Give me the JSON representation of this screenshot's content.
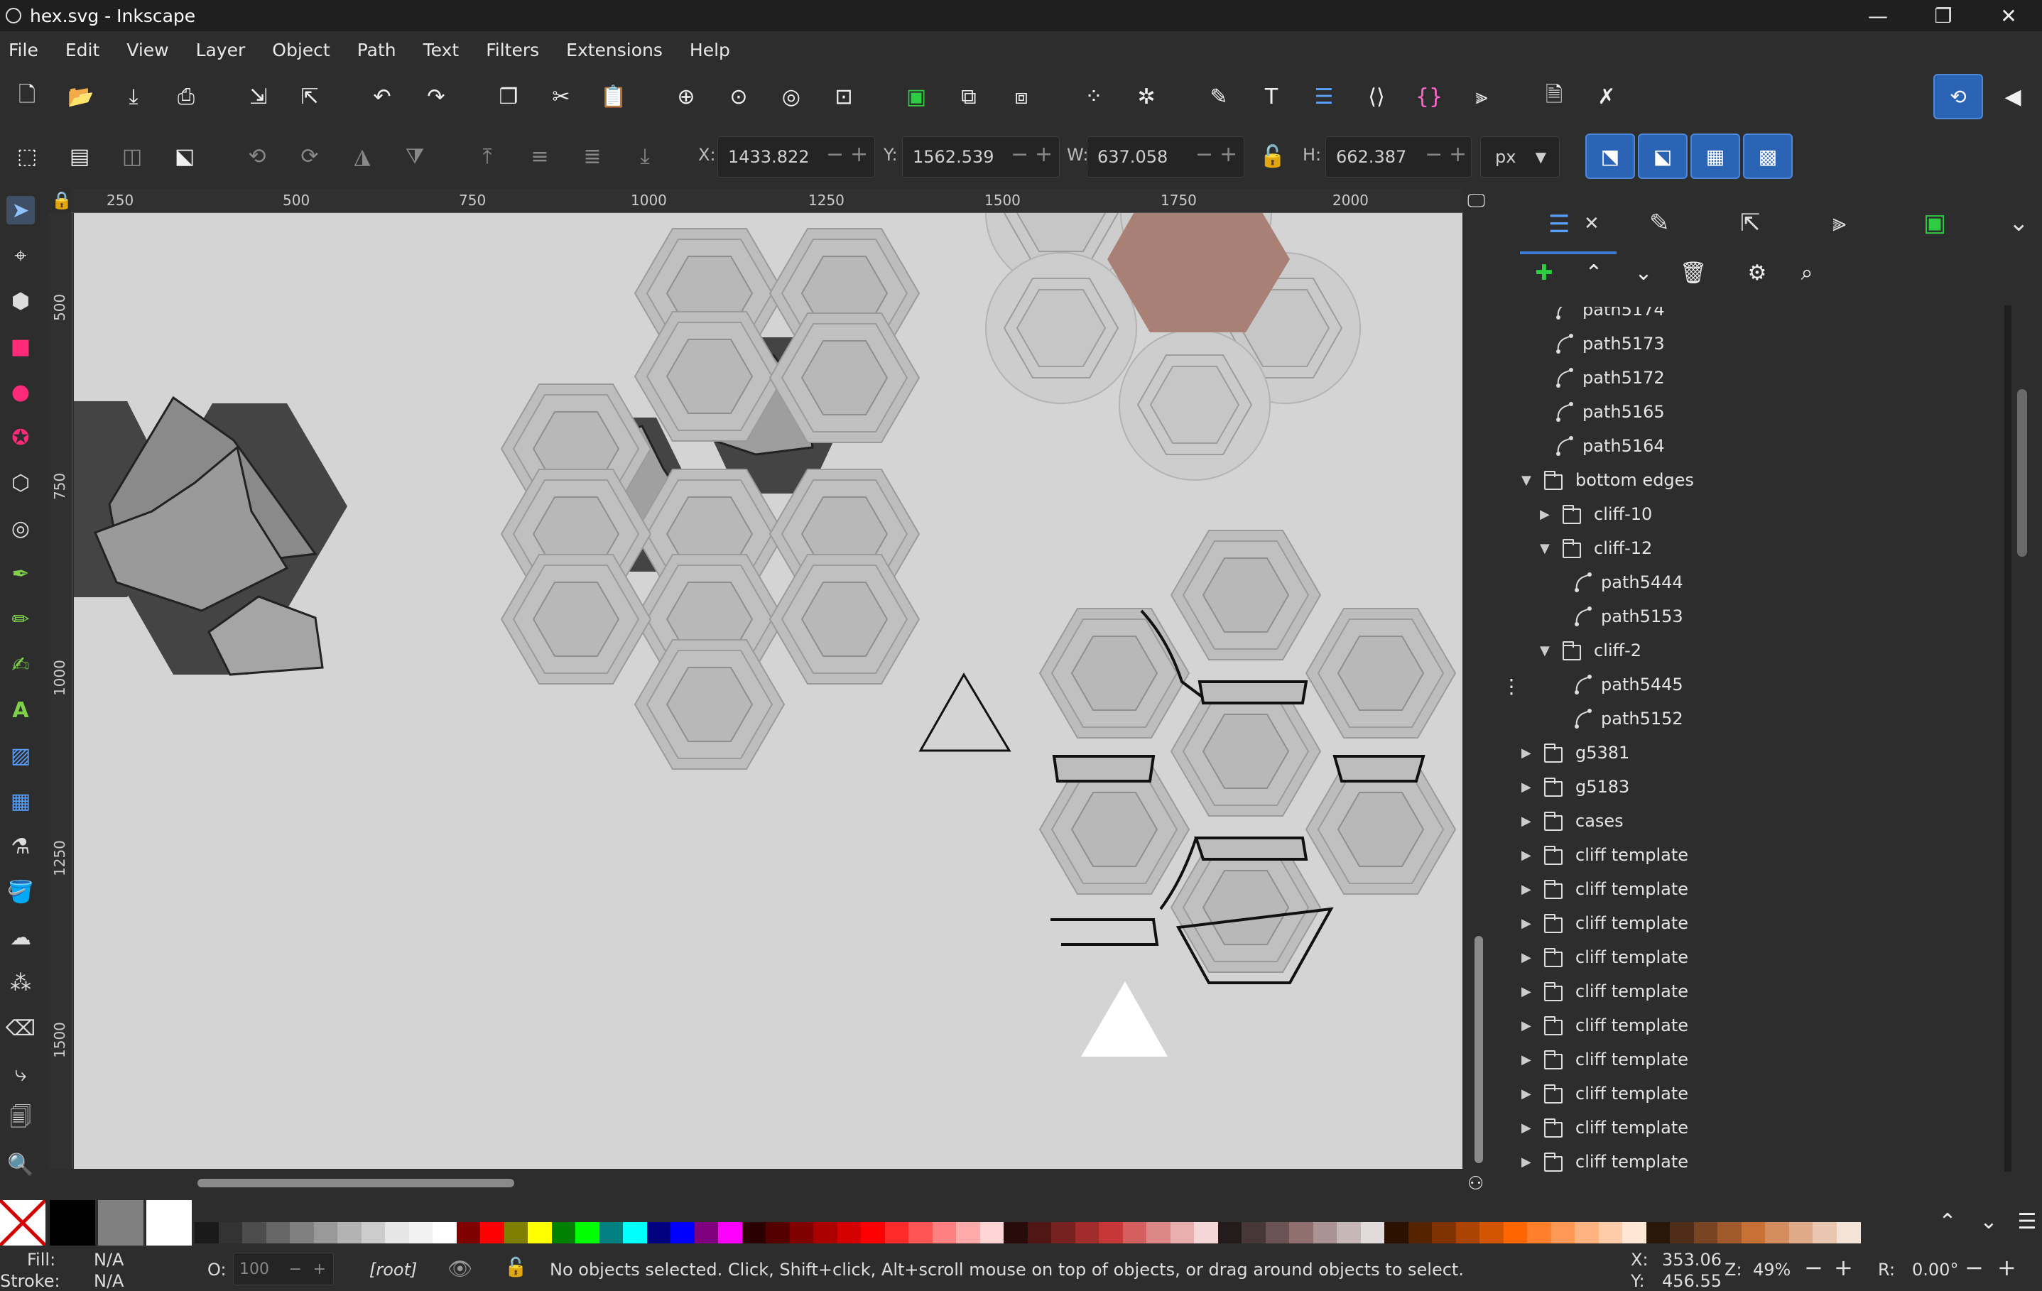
{
  "window": {
    "title": "hex.svg - Inkscape",
    "controls": {
      "minimize": "—",
      "maximize": "❐",
      "close": "✕"
    }
  },
  "menu": [
    "File",
    "Edit",
    "View",
    "Layer",
    "Object",
    "Path",
    "Text",
    "Filters",
    "Extensions",
    "Help"
  ],
  "toolbar": {
    "labels": {
      "x": "X:",
      "y": "Y:",
      "w": "W:",
      "h": "H:"
    },
    "x": "1433.822",
    "y": "1562.539",
    "w": "637.058",
    "h": "662.387",
    "unit": "px"
  },
  "ruler": {
    "h": [
      "250",
      "500",
      "750",
      "1000",
      "1250",
      "1500",
      "1750",
      "2000"
    ],
    "v": [
      "500",
      "750",
      "1000",
      "1250",
      "1500"
    ]
  },
  "layers": [
    {
      "name": "path5174",
      "depth": 2,
      "kind": "path",
      "expander": ""
    },
    {
      "name": "path5173",
      "depth": 2,
      "kind": "path",
      "expander": ""
    },
    {
      "name": "path5172",
      "depth": 2,
      "kind": "path",
      "expander": ""
    },
    {
      "name": "path5165",
      "depth": 2,
      "kind": "path",
      "expander": ""
    },
    {
      "name": "path5164",
      "depth": 2,
      "kind": "path",
      "expander": ""
    },
    {
      "name": "bottom edges",
      "depth": 0,
      "kind": "group",
      "expander": "▼"
    },
    {
      "name": "cliff-10",
      "depth": 1,
      "kind": "group",
      "expander": "▶"
    },
    {
      "name": "cliff-12",
      "depth": 1,
      "kind": "group",
      "expander": "▼"
    },
    {
      "name": "path5444",
      "depth": 3,
      "kind": "path",
      "expander": ""
    },
    {
      "name": "path5153",
      "depth": 3,
      "kind": "path",
      "expander": ""
    },
    {
      "name": "cliff-2",
      "depth": 1,
      "kind": "group",
      "expander": "▼"
    },
    {
      "name": "path5445",
      "depth": 3,
      "kind": "path",
      "expander": ""
    },
    {
      "name": "path5152",
      "depth": 3,
      "kind": "path",
      "expander": ""
    },
    {
      "name": "g5381",
      "depth": 0,
      "kind": "group",
      "expander": "▶"
    },
    {
      "name": "g5183",
      "depth": 0,
      "kind": "group",
      "expander": "▶"
    },
    {
      "name": "cases",
      "depth": 0,
      "kind": "group",
      "expander": "▶"
    },
    {
      "name": "cliff template",
      "depth": 0,
      "kind": "group",
      "expander": "▶"
    },
    {
      "name": "cliff template",
      "depth": 0,
      "kind": "group",
      "expander": "▶"
    },
    {
      "name": "cliff template",
      "depth": 0,
      "kind": "group",
      "expander": "▶"
    },
    {
      "name": "cliff template",
      "depth": 0,
      "kind": "group",
      "expander": "▶"
    },
    {
      "name": "cliff template",
      "depth": 0,
      "kind": "group",
      "expander": "▶"
    },
    {
      "name": "cliff template",
      "depth": 0,
      "kind": "group",
      "expander": "▶"
    },
    {
      "name": "cliff template",
      "depth": 0,
      "kind": "group",
      "expander": "▶"
    },
    {
      "name": "cliff template",
      "depth": 0,
      "kind": "group",
      "expander": "▶"
    },
    {
      "name": "cliff template",
      "depth": 0,
      "kind": "group",
      "expander": "▶"
    },
    {
      "name": "cliff template",
      "depth": 0,
      "kind": "group",
      "expander": "▶"
    },
    {
      "name": "cliff template",
      "depth": 0,
      "kind": "group",
      "expander": "▶"
    }
  ],
  "palette": {
    "fixed": [
      "#000000",
      "#808080",
      "#ffffff"
    ],
    "swatches": [
      "#1a1a1a",
      "#333333",
      "#4d4d4d",
      "#666666",
      "#808080",
      "#999999",
      "#b3b3b3",
      "#cccccc",
      "#e6e6e6",
      "#f2f2f2",
      "#ffffff",
      "#800000",
      "#ff0000",
      "#808000",
      "#ffff00",
      "#008000",
      "#00ff00",
      "#008080",
      "#00ffff",
      "#000080",
      "#0000ff",
      "#800080",
      "#ff00ff",
      "#2b0000",
      "#550000",
      "#800000",
      "#aa0000",
      "#d40000",
      "#ff0000",
      "#ff2a2a",
      "#ff5555",
      "#ff8080",
      "#ffaaaa",
      "#ffd5d5",
      "#280b0b",
      "#501616",
      "#782121",
      "#a02c2c",
      "#c83737",
      "#d35f5f",
      "#de8787",
      "#e9afaf",
      "#f4d7d7",
      "#241c1c",
      "#483737",
      "#6c5353",
      "#916f6f",
      "#ac9393",
      "#c8b7b7",
      "#e3dbdb",
      "#2b1100",
      "#552200",
      "#803300",
      "#aa4400",
      "#d45500",
      "#ff6600",
      "#ff7f2a",
      "#ff9955",
      "#ffb380",
      "#ffccaa",
      "#ffe6d5",
      "#28170b",
      "#502d16",
      "#784421",
      "#a05a2c",
      "#c87137",
      "#d38d5f",
      "#deaa87",
      "#e9c6af",
      "#f4e3d7"
    ]
  },
  "status": {
    "fill_label": "Fill:",
    "fill_value": "N/A",
    "stroke_label": "Stroke:",
    "stroke_value": "N/A",
    "opacity_label": "O:",
    "opacity": "100",
    "layer": "[root]",
    "message": "No objects selected. Click, Shift+click, Alt+scroll mouse on top of objects, or drag around objects to select.",
    "x_label": "X:",
    "x": "353.06",
    "y_label": "Y:",
    "y": "456.55",
    "zoom_label": "Z:",
    "zoom": "49%",
    "rot_label": "R:",
    "rotation": "0.00°"
  }
}
